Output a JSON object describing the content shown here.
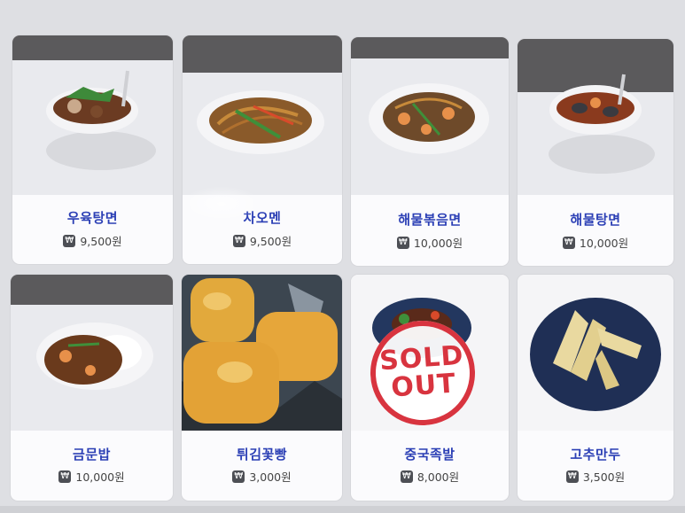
{
  "menu": {
    "currency_icon": "won-icon",
    "items": [
      {
        "name": "우육탕면",
        "price": "9,500원",
        "sold_out": false
      },
      {
        "name": "차오멘",
        "price": "9,500원",
        "sold_out": false
      },
      {
        "name": "해물볶음면",
        "price": "10,000원",
        "sold_out": false
      },
      {
        "name": "해물탕면",
        "price": "10,000원",
        "sold_out": false
      },
      {
        "name": "금문밥",
        "price": "10,000원",
        "sold_out": false
      },
      {
        "name": "튀김꽃빵",
        "price": "3,000원",
        "sold_out": false
      },
      {
        "name": "중국족발",
        "price": "8,000원",
        "sold_out": true,
        "badge_line1": "SOLD",
        "badge_line2": "OUT"
      },
      {
        "name": "고추만두",
        "price": "3,500원",
        "sold_out": false
      }
    ]
  },
  "colors": {
    "item_name": "#2b3fb5",
    "sold_out_red": "#d8343f"
  }
}
